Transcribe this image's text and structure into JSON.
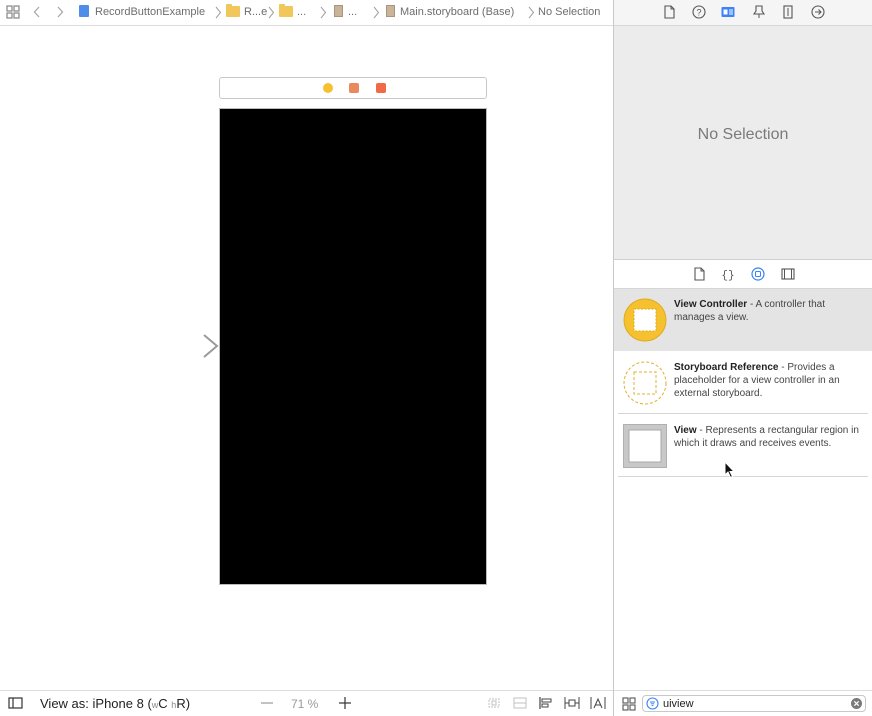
{
  "jumpbar": {
    "crumbs": [
      "RecordButtonExample",
      "R...e",
      "...",
      "...",
      "Main.storyboard (Base)",
      "No Selection"
    ]
  },
  "bottombar": {
    "view_as_prefix": "View as: iPhone 8 (",
    "size_w": "w",
    "size_c": "C",
    "size_h": "h",
    "size_r": "R",
    "view_as_suffix": ")",
    "zoom": "71 %"
  },
  "inspector": {
    "no_selection": "No Selection"
  },
  "library": {
    "items": [
      {
        "title": "View Controller",
        "desc": " - A controller that manages a view.",
        "selected": true,
        "icon": "view-controller-icon"
      },
      {
        "title": "Storyboard Reference",
        "desc": " - Provides a placeholder for a view controller in an external storyboard.",
        "selected": false,
        "icon": "storyboard-reference-icon"
      },
      {
        "title": "View",
        "desc": " - Represents a rectangular region in which it draws and receives events.",
        "selected": false,
        "icon": "view-icon"
      }
    ]
  },
  "filter": {
    "value": "uiview"
  },
  "colors": {
    "scene_background": "#000000",
    "accent_blue": "#3a82f7",
    "vc_yellow": "#f5c12e"
  }
}
